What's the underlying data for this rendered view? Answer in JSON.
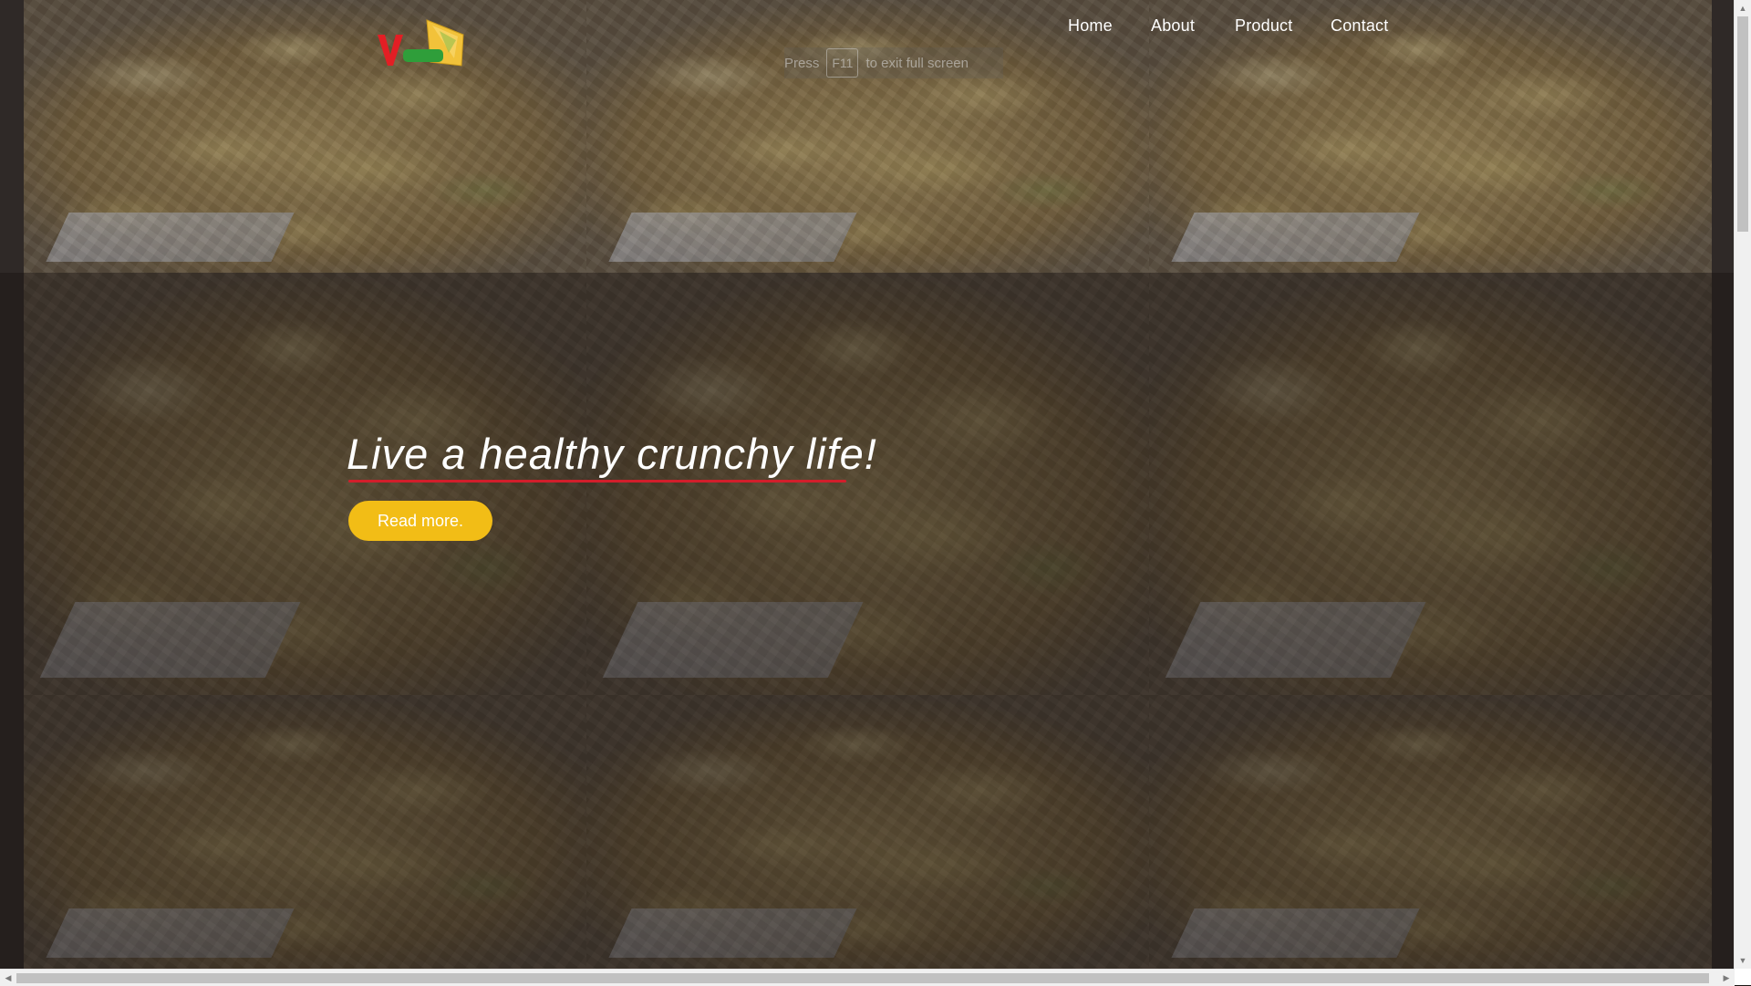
{
  "logo": {
    "alt": "logo",
    "colors": {
      "letter": "#e31e24",
      "text": "#2f9e3a",
      "chip": "#f2c23a"
    }
  },
  "nav": {
    "home": "Home",
    "about": "About",
    "product": "Product",
    "contact": "Contact"
  },
  "fullscreen_hint": {
    "before": "Press",
    "key": "F11",
    "after": "to exit full screen"
  },
  "hero": {
    "title": "Live a healthy crunchy life!",
    "button_label": "Read more.",
    "accent_color": "#f2bd16",
    "underline_color": "#d21e2b"
  },
  "scrollbars": {
    "up_icon": "triangle-up-icon",
    "down_icon": "triangle-down-icon",
    "left_icon": "triangle-left-icon",
    "right_icon": "triangle-right-icon"
  }
}
